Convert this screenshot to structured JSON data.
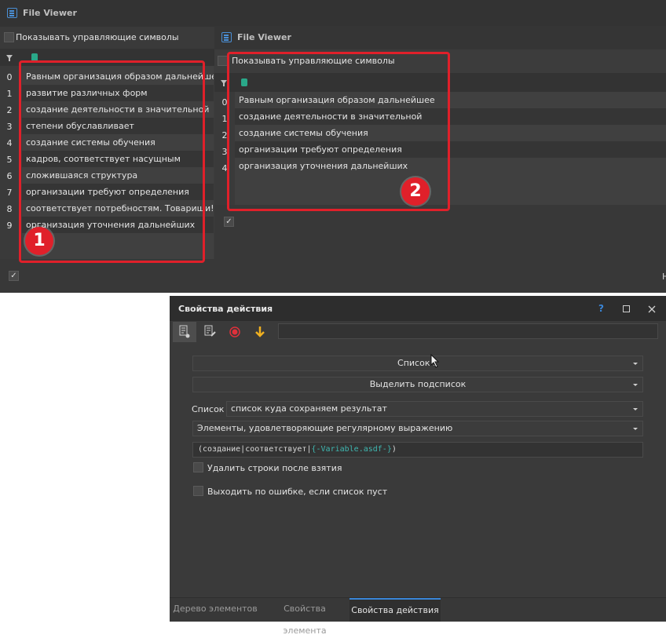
{
  "fv1": {
    "title": "File Viewer",
    "show_control_chars": "Показывать управляющие символы",
    "indices": [
      "0",
      "1",
      "2",
      "3",
      "4",
      "5",
      "6",
      "7",
      "8",
      "9"
    ],
    "rows": [
      "Равным организация образом дальнейшее",
      "развитие различных форм",
      "создание деятельности в значительной",
      "степени обуславливает",
      "создание системы обучения",
      "кадров, соответствует насущным",
      "сложившаяся структура",
      "организации требуют определения",
      "соответствует потребностям. Товарищи!",
      "организация уточнения дальнейших"
    ],
    "check_mark": "✓",
    "cut_text": "Н"
  },
  "fv2": {
    "title": "File Viewer",
    "show_control_chars": "Показывать управляющие символы",
    "indices": [
      "0",
      "1",
      "2",
      "3",
      "4"
    ],
    "rows": [
      "Равным организация образом дальнейшее",
      "создание деятельности в значительной",
      "создание системы обучения",
      "организации требуют определения",
      "организация уточнения дальнейших"
    ],
    "check_mark": "✓"
  },
  "badges": {
    "one": "1",
    "two": "2"
  },
  "props": {
    "title": "Свойства действия",
    "help": "?",
    "toolbar_input": "",
    "list_select": "Список 1",
    "action_select": "Выделить подсписок",
    "list_label": "Список",
    "list_name": "список куда сохраняем результат",
    "mode_select": "Элементы, удовлетворяющие регулярному выражению",
    "regex": {
      "p1": "(создание|соответствует|",
      "p2": "{-Variable.asdf-}",
      "p3": ")"
    },
    "delete_rows": "Удалить строки после взятия",
    "exit_on_error": "Выходить по ошибке, если список пуст",
    "tabs": [
      "Дерево элементов",
      "Свойства элемента",
      "Свойства действия"
    ],
    "active_tab": 2
  },
  "colors": {
    "accent": "#3a86d8",
    "highlight": "#e0202a",
    "panel": "#3c3c3c"
  }
}
